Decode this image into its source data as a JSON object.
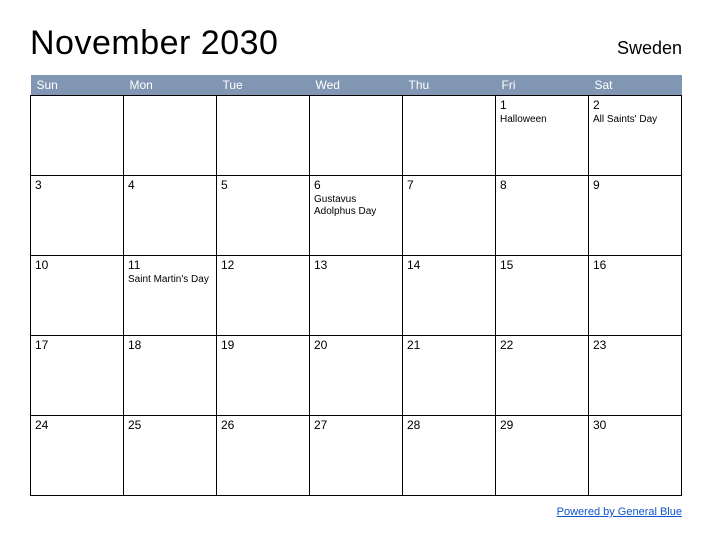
{
  "header": {
    "title": "November 2030",
    "region": "Sweden"
  },
  "daysOfWeek": [
    "Sun",
    "Mon",
    "Tue",
    "Wed",
    "Thu",
    "Fri",
    "Sat"
  ],
  "weeks": [
    [
      {
        "day": "",
        "event": ""
      },
      {
        "day": "",
        "event": ""
      },
      {
        "day": "",
        "event": ""
      },
      {
        "day": "",
        "event": ""
      },
      {
        "day": "",
        "event": ""
      },
      {
        "day": "1",
        "event": "Halloween"
      },
      {
        "day": "2",
        "event": "All Saints' Day"
      }
    ],
    [
      {
        "day": "3",
        "event": ""
      },
      {
        "day": "4",
        "event": ""
      },
      {
        "day": "5",
        "event": ""
      },
      {
        "day": "6",
        "event": "Gustavus Adolphus Day"
      },
      {
        "day": "7",
        "event": ""
      },
      {
        "day": "8",
        "event": ""
      },
      {
        "day": "9",
        "event": ""
      }
    ],
    [
      {
        "day": "10",
        "event": ""
      },
      {
        "day": "11",
        "event": "Saint Martin's Day"
      },
      {
        "day": "12",
        "event": ""
      },
      {
        "day": "13",
        "event": ""
      },
      {
        "day": "14",
        "event": ""
      },
      {
        "day": "15",
        "event": ""
      },
      {
        "day": "16",
        "event": ""
      }
    ],
    [
      {
        "day": "17",
        "event": ""
      },
      {
        "day": "18",
        "event": ""
      },
      {
        "day": "19",
        "event": ""
      },
      {
        "day": "20",
        "event": ""
      },
      {
        "day": "21",
        "event": ""
      },
      {
        "day": "22",
        "event": ""
      },
      {
        "day": "23",
        "event": ""
      }
    ],
    [
      {
        "day": "24",
        "event": ""
      },
      {
        "day": "25",
        "event": ""
      },
      {
        "day": "26",
        "event": ""
      },
      {
        "day": "27",
        "event": ""
      },
      {
        "day": "28",
        "event": ""
      },
      {
        "day": "29",
        "event": ""
      },
      {
        "day": "30",
        "event": ""
      }
    ]
  ],
  "footer": {
    "link_text": "Powered by General Blue"
  }
}
